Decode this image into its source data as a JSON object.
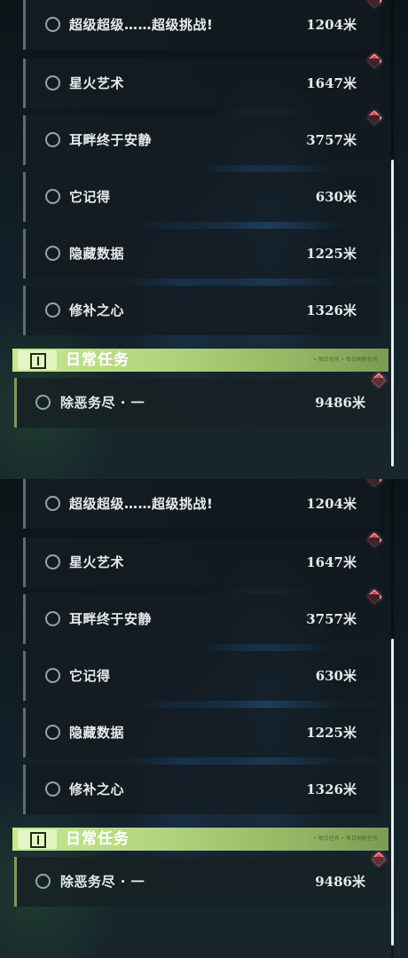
{
  "quests": [
    {
      "name": "超级超级……超级挑战!",
      "distance": "1204米"
    },
    {
      "name": "星火艺术",
      "distance": "1647米"
    },
    {
      "name": "耳畔终于安静",
      "distance": "3757米"
    },
    {
      "name": "它记得",
      "distance": "630米"
    },
    {
      "name": "隐藏数据",
      "distance": "1225米"
    },
    {
      "name": "修补之心",
      "distance": "1326米"
    }
  ],
  "daily": {
    "title": "日常任务",
    "subtitle": "• 每日任务 • 每日刷新任务",
    "items": [
      {
        "name": "除恶务尽 · 一",
        "distance": "9486米"
      }
    ]
  },
  "colors": {
    "section_green": "#b2d47e",
    "tracked_marker": "#e04250"
  },
  "icons": {
    "quest_status": "circle-outline-icon",
    "tracked": "red-diamond-marker-icon",
    "daily": "exclamation-box-icon"
  }
}
